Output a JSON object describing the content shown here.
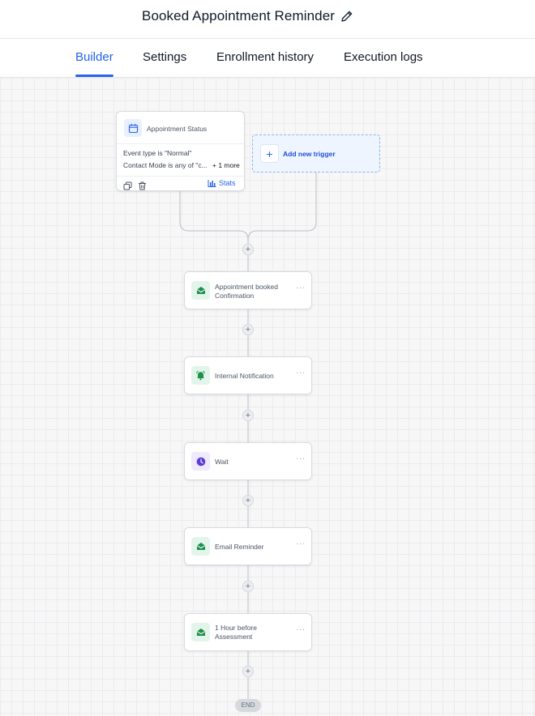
{
  "header": {
    "title": "Booked Appointment Reminder",
    "edit_icon": "pencil-icon"
  },
  "tabs": [
    {
      "label": "Builder",
      "active": true
    },
    {
      "label": "Settings",
      "active": false
    },
    {
      "label": "Enrollment history",
      "active": false
    },
    {
      "label": "Execution logs",
      "active": false
    }
  ],
  "trigger": {
    "icon": "calendar-icon",
    "title": "Appointment Status",
    "conditions": [
      "Event type is \"Normal\"",
      "Contact Mode is any of \"c..."
    ],
    "more_label": "+ 1 more",
    "stats_label": "Stats",
    "copy_icon": "copy-icon",
    "delete_icon": "trash-icon",
    "stats_icon": "bar-chart-icon"
  },
  "add_trigger": {
    "plus_label": "+",
    "label": "Add new trigger"
  },
  "actions": [
    {
      "icon": "envelope-icon",
      "lines": [
        "Appointment booked",
        "Confirmation"
      ],
      "color": "#1f8f4e"
    },
    {
      "icon": "bell-icon",
      "lines": [
        "Internal Notification"
      ],
      "color": "#1f8f4e"
    },
    {
      "icon": "clock-icon",
      "lines": [
        "Wait"
      ],
      "color": "#5b3ed6"
    },
    {
      "icon": "envelope-icon",
      "lines": [
        "Email Reminder"
      ],
      "color": "#1f8f4e"
    },
    {
      "icon": "envelope-icon",
      "lines": [
        "1 Hour before",
        "Assessment"
      ],
      "color": "#1f8f4e"
    }
  ],
  "menu_label": "···",
  "plus_label": "+",
  "end_label": "END",
  "colors": {
    "accent": "#2563eb",
    "action_green": "#1f8f4e",
    "wait_purple": "#5b3ed6"
  }
}
